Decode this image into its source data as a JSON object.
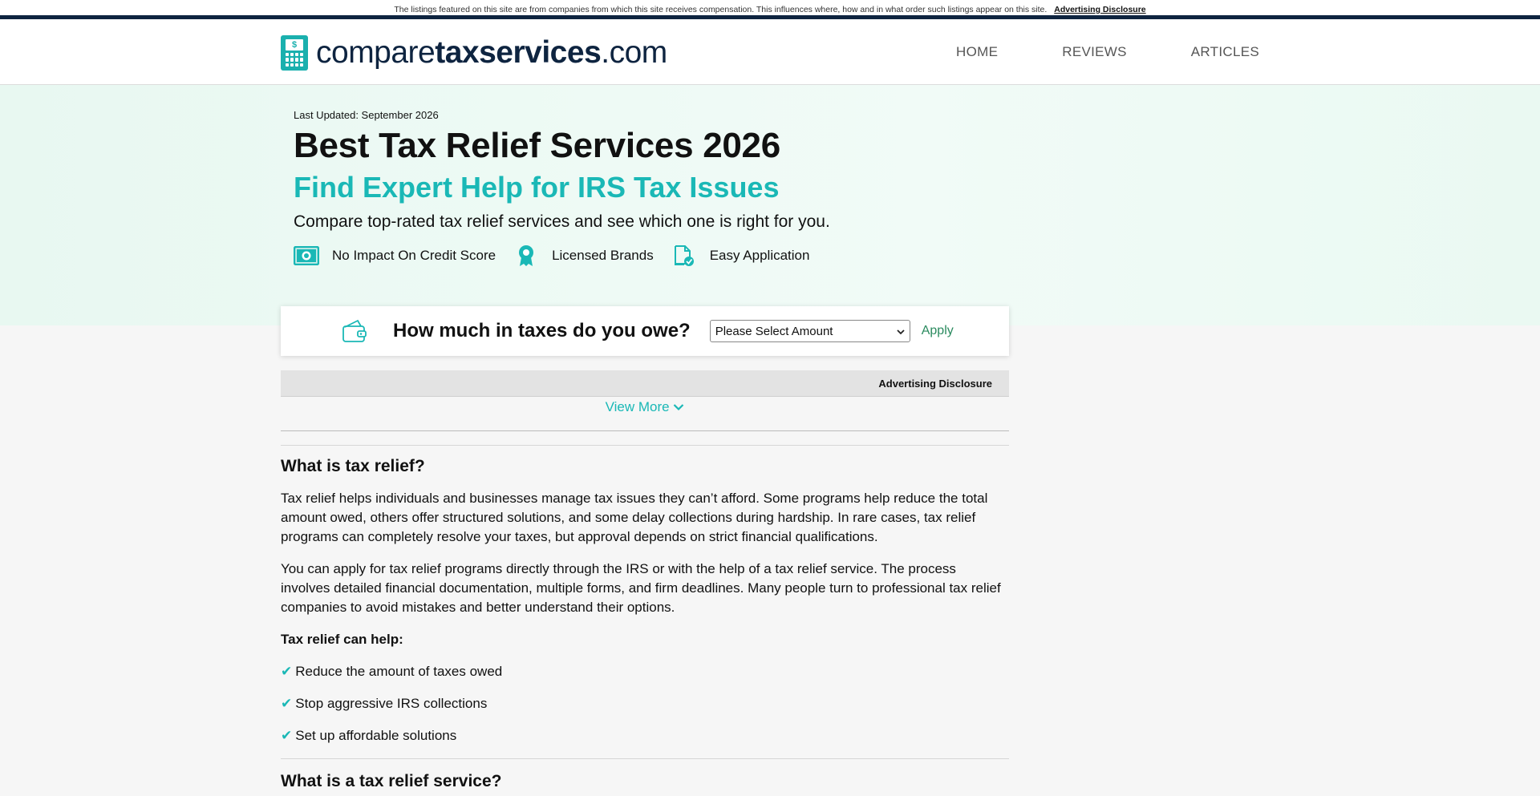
{
  "disclosure_bar": {
    "text": "The listings featured on this site are from companies from which this site receives compensation. This influences where, how and in what order such listings appear on this site.",
    "link": "Advertising Disclosure"
  },
  "logo": {
    "prefix": "compare",
    "bold": "taxservices",
    "suffix": ".com",
    "icon_symbol": "$"
  },
  "nav": {
    "items": [
      "HOME",
      "REVIEWS",
      "ARTICLES"
    ]
  },
  "hero": {
    "updated": "Last Updated: September 2026",
    "title": "Best Tax Relief Services 2026",
    "subtitle": "Find Expert Help for IRS Tax Issues",
    "tagline": "Compare top-rated tax relief services and see which one is right for you.",
    "features": [
      {
        "label": "No Impact On Credit Score",
        "icon": "money-icon"
      },
      {
        "label": "Licensed Brands",
        "icon": "badge-icon"
      },
      {
        "label": "Easy Application",
        "icon": "document-check-icon"
      }
    ]
  },
  "owe_box": {
    "label": "How much in taxes do you owe?",
    "select_value": "Please Select Amount",
    "apply": "Apply"
  },
  "ad_row": {
    "label": "Advertising Disclosure"
  },
  "view_more": "View More",
  "article": {
    "h1": "What is tax relief?",
    "p1": "Tax relief helps individuals and businesses manage tax issues they can’t afford. Some programs help reduce the total amount owed, others offer structured solutions, and some delay collections during hardship. In rare cases, tax relief programs can completely resolve your taxes, but approval depends on strict financial qualifications.",
    "p2": "You can apply for tax relief programs directly through the IRS or with the help of a tax relief service. The process involves detailed financial documentation, multiple forms, and firm deadlines. Many people turn to professional tax relief companies to avoid mistakes and better understand their options.",
    "help_label": "Tax relief can help:",
    "help_items": [
      "Reduce the amount of taxes owed",
      "Stop aggressive IRS collections",
      "Set up affordable solutions"
    ],
    "h2": "What is a tax relief service?"
  },
  "colors": {
    "accent": "#1ab8b6",
    "navy": "#0e2440",
    "apply_green": "#2a8a5e"
  }
}
